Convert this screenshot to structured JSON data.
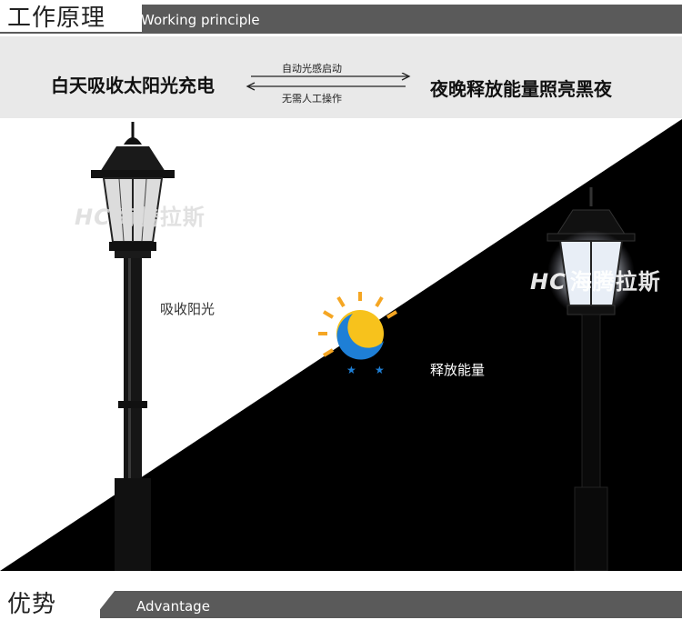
{
  "header": {
    "title_cn": "工作原理",
    "title_en": "Working principle"
  },
  "flow": {
    "left": "白天吸收太阳光充电",
    "right": "夜晚释放能量照亮黑夜",
    "arrow_top": "自动光感启动",
    "arrow_bottom": "无需人工操作"
  },
  "scene": {
    "label_day": "吸收阳光",
    "label_night": "释放能量",
    "watermark_logo": "HC",
    "watermark_text": "海腾拉斯",
    "icon": "sun-moon-icon"
  },
  "footer": {
    "title_cn": "优势",
    "title_en": "Advantage"
  },
  "colors": {
    "header_band": "#5a5a5a",
    "flow_bg": "#e9e9e9",
    "night": "#000000",
    "sun": "#f5a623",
    "moon": "#1e7fd6"
  }
}
